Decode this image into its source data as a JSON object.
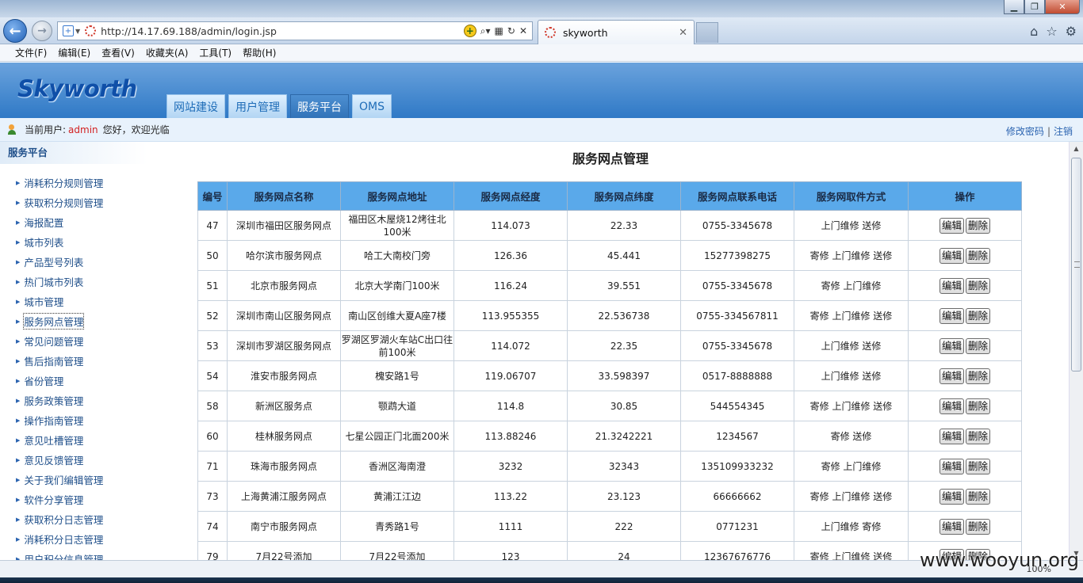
{
  "browser": {
    "url": "http://14.17.69.188/admin/login.jsp",
    "tab_title": "skyworth",
    "zoom": "100%"
  },
  "menu": [
    "文件(F)",
    "编辑(E)",
    "查看(V)",
    "收藏夹(A)",
    "工具(T)",
    "帮助(H)"
  ],
  "header": {
    "logo": "Skyworth",
    "nav": [
      "网站建设",
      "用户管理",
      "服务平台",
      "OMS"
    ],
    "active_nav": "服务平台"
  },
  "userbar": {
    "label": "当前用户:",
    "username": "admin",
    "welcome": "您好，欢迎光临",
    "change_password": "修改密码",
    "separator": "|",
    "logout": "注销"
  },
  "sidebar": {
    "title": "服务平台",
    "items": [
      "消耗积分规则管理",
      "获取积分规则管理",
      "海报配置",
      "城市列表",
      "产品型号列表",
      "热门城市列表",
      "城市管理",
      "服务网点管理",
      "常见问题管理",
      "售后指南管理",
      "省份管理",
      "服务政策管理",
      "操作指南管理",
      "意见吐槽管理",
      "意见反馈管理",
      "关于我们编辑管理",
      "软件分享管理",
      "获取积分日志管理",
      "消耗积分日志管理",
      "用户积分信息管理"
    ],
    "active_item": "服务网点管理"
  },
  "main": {
    "title": "服务网点管理",
    "columns": [
      "编号",
      "服务网点名称",
      "服务网点地址",
      "服务网点经度",
      "服务网点纬度",
      "服务网点联系电话",
      "服务网取件方式",
      "操作"
    ],
    "edit_label": "编辑",
    "delete_label": "删除",
    "rows": [
      [
        "47",
        "深圳市福田区服务网点",
        "福田区木屋烧12烤往北100米",
        "114.073",
        "22.33",
        "0755-3345678",
        "上门维修 送修"
      ],
      [
        "50",
        "哈尔滨市服务网点",
        "哈工大南校门旁",
        "126.36",
        "45.441",
        "15277398275",
        "寄修 上门维修 送修"
      ],
      [
        "51",
        "北京市服务网点",
        "北京大学南门100米",
        "116.24",
        "39.551",
        "0755-3345678",
        "寄修 上门维修"
      ],
      [
        "52",
        "深圳市南山区服务网点",
        "南山区创维大夏A座7楼",
        "113.955355",
        "22.536738",
        "0755-334567811",
        "寄修 上门维修 送修"
      ],
      [
        "53",
        "深圳市罗湖区服务网点",
        "罗湖区罗湖火车站C出口往前100米",
        "114.072",
        "22.35",
        "0755-3345678",
        "上门维修 送修"
      ],
      [
        "54",
        "淮安市服务网点",
        "槐安路1号",
        "119.06707",
        "33.598397",
        "0517-8888888",
        "上门维修 送修"
      ],
      [
        "58",
        "新洲区服务点",
        "颚鹉大道",
        "114.8",
        "30.85",
        "544554345",
        "寄修 上门维修 送修"
      ],
      [
        "60",
        "桂林服务网点",
        "七星公园正门北面200米",
        "113.88246",
        "21.3242221",
        "1234567",
        "寄修 送修"
      ],
      [
        "71",
        "珠海市服务网点",
        "香洲区海南澄",
        "3232",
        "32343",
        "135109933232",
        "寄修 上门维修"
      ],
      [
        "73",
        "上海黄浦江服务网点",
        "黄浦江江边",
        "113.22",
        "23.123",
        "66666662",
        "寄修 上门维修 送修"
      ],
      [
        "74",
        "南宁市服务网点",
        "青秀路1号",
        "1111",
        "222",
        "0771231",
        "上门维修 寄修"
      ],
      [
        "79",
        "7月22号添加",
        "7月22号添加",
        "123",
        "24",
        "12367676776",
        "寄修 上门维修 送修"
      ]
    ]
  },
  "watermark": "www.wooyun.org"
}
